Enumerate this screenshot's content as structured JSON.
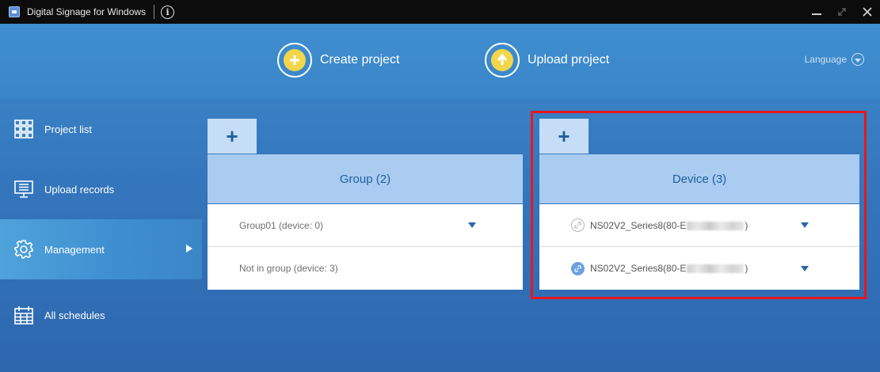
{
  "window": {
    "title": "Digital Signage for Windows",
    "info_icon": "info-icon",
    "controls": [
      "minimize-icon",
      "maximize-icon",
      "close-icon"
    ]
  },
  "header": {
    "create_label": "Create project",
    "upload_label": "Upload project",
    "language_label": "Language"
  },
  "sidebar": {
    "items": [
      {
        "label": "Project list",
        "icon": "grid-icon"
      },
      {
        "label": "Upload records",
        "icon": "monitor-list-icon"
      },
      {
        "label": "Management",
        "icon": "gear-icon",
        "active": true
      },
      {
        "label": "All schedules",
        "icon": "calendar-icon"
      }
    ]
  },
  "group_panel": {
    "add_label": "+",
    "header": "Group (2)",
    "rows": [
      {
        "label": "Group01 (device: 0)"
      },
      {
        "label": "Not in group (device: 3)"
      }
    ]
  },
  "device_panel": {
    "add_label": "+",
    "header": "Device (3)",
    "rows": [
      {
        "prefix": "NS02V2_Series8(80-E",
        "suffix": ")",
        "status": "disconnected"
      },
      {
        "prefix": "NS02V2_Series8(80-E",
        "suffix": ")",
        "status": "connected"
      }
    ]
  },
  "colors": {
    "background": "#2e6eb5",
    "panel_header": "#a9ccf0",
    "add_button": "#c6ddf6",
    "accent_yellow": "#f3d64a",
    "highlight": "#e8161e"
  }
}
